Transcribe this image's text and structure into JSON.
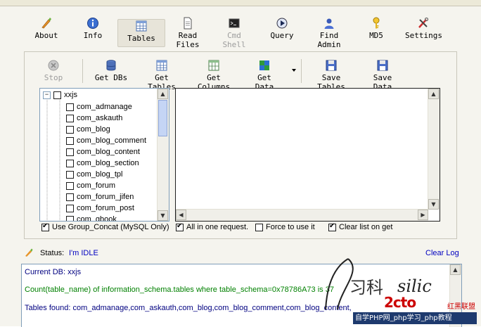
{
  "toolbar": [
    {
      "key": "about",
      "label": "About",
      "icon": "carrot-pen-icon"
    },
    {
      "key": "info",
      "label": "Info",
      "icon": "info-icon"
    },
    {
      "key": "tables",
      "label": "Tables",
      "icon": "table-icon",
      "active": true
    },
    {
      "key": "read_files",
      "label": "Read Files",
      "icon": "document-icon"
    },
    {
      "key": "cmd_shell",
      "label": "Cmd Shell",
      "icon": "terminal-icon",
      "disabled": true
    },
    {
      "key": "query",
      "label": "Query",
      "icon": "query-icon"
    },
    {
      "key": "find_admin",
      "label": "Find Admin",
      "icon": "user-icon"
    },
    {
      "key": "md5",
      "label": "MD5",
      "icon": "key-icon"
    },
    {
      "key": "settings",
      "label": "Settings",
      "icon": "tools-icon"
    }
  ],
  "subtoolbar": {
    "stop": "Stop",
    "get_dbs": "Get DBs",
    "get_tables": "Get Tables",
    "get_columns": "Get Columns",
    "get_data": "Get Data",
    "save_tables": "Save Tables",
    "save_data": "Save Data"
  },
  "tree": {
    "root": "xxjs",
    "items": [
      "com_admanage",
      "com_askauth",
      "com_blog",
      "com_blog_comment",
      "com_blog_content",
      "com_blog_section",
      "com_blog_tpl",
      "com_forum",
      "com_forum_jifen",
      "com_forum_post",
      "com_gbook"
    ]
  },
  "options": {
    "use_group_concat": "Use Group_Concat (MySQL Only)",
    "all_in_one": "All in one request.",
    "force_to_use": "Force to use it",
    "clear_list": "Clear list on get"
  },
  "status": {
    "label": "Status:",
    "value": "I'm IDLE",
    "clear_log": "Clear Log"
  },
  "log": {
    "line1": "Current DB: xxjs",
    "line2": "Count(table_name) of information_schema.tables where table_schema=0x78786A73 is 37",
    "line3": "Tables found: com_admanage,com_askauth,com_blog,com_blog_comment,com_blog_content,"
  },
  "colors": {
    "log_line1": "#000080",
    "log_line2": "#008000",
    "log_line3": "#000080",
    "link": "#0000c0"
  },
  "watermark": {
    "script": "silic",
    "chars": "习科",
    "brand": "2cto",
    "brand_cn": "红黑联盟",
    "footer": "自学PHP网_php学习_php教程"
  }
}
